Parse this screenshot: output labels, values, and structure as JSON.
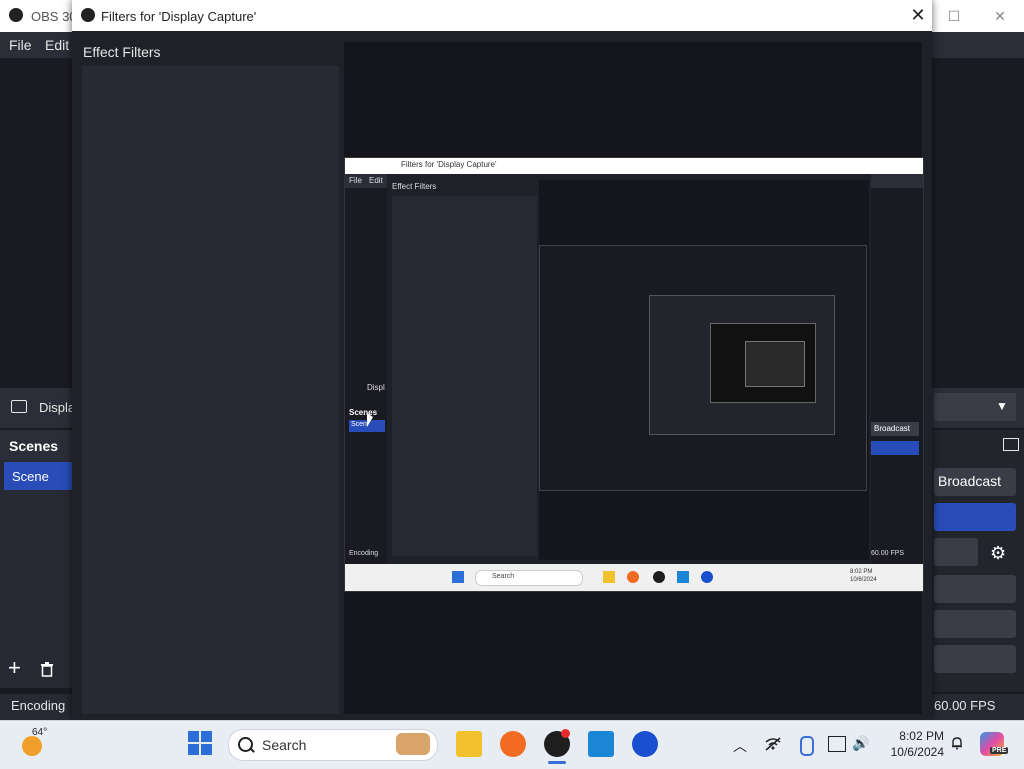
{
  "obs": {
    "title": "OBS 30.",
    "menu": [
      "File",
      "Edit"
    ],
    "source_label": "Displa",
    "scenes_header": "Scenes",
    "scene_item": "Scene",
    "encoding": "Encoding",
    "fps": "60.00 FPS",
    "broadcast": "Broadcast"
  },
  "filters_dialog": {
    "title": "Filters for 'Display Capture'",
    "effect_filters": "Effect Filters",
    "close": "✕"
  },
  "nested": {
    "title": "Filters for 'Display Capture'",
    "menu": [
      "File",
      "Edit"
    ],
    "effect_filters": "Effect Filters",
    "source_label": "Displ",
    "scenes": "Scenes",
    "scene": "Scen",
    "encoding": "Encoding",
    "broadcast": "Broadcast",
    "fps": "60.00 FPS",
    "search": "Search",
    "clock_time": "8:02 PM",
    "clock_date": "10/6/2024"
  },
  "taskbar": {
    "weather_temp": "64°",
    "search_placeholder": "Search",
    "clock_time": "8:02 PM",
    "clock_date": "10/6/2024",
    "copilot_badge": "PRE",
    "tray_chevron": "︿",
    "volume": "🔊"
  },
  "window_controls": {
    "minimize": "—",
    "maximize": "☐",
    "close": "✕"
  },
  "colors": {
    "accent": "#284cb8",
    "panel": "#272a33",
    "bg": "#1f2128"
  }
}
